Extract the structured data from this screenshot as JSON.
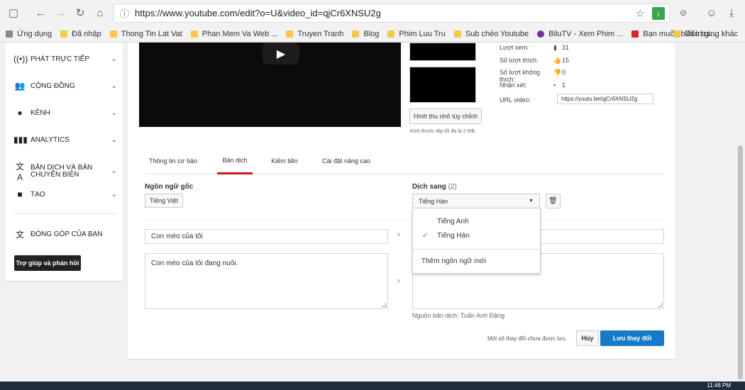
{
  "browser": {
    "url": "https://www.youtube.com/edit?o=U&video_id=qjCr6XNSU2g",
    "bookmarks": [
      "Ứng dụng",
      "Đã nhập",
      "Thong Tin Lat Vat",
      "Phan Mem Va Web ...",
      "Truyen Tranh",
      "Blog",
      "Phim Luu Tru",
      "Sub chéo Youtube",
      "BiluTV - Xem Phim ...",
      "Bạn muốn biết trị gi...",
      "Dấu trang khác"
    ],
    "icons": [
      "back-icon",
      "forward-icon",
      "reload-icon",
      "home-icon",
      "info-icon",
      "star-icon",
      "extension-icon",
      "menu-icon"
    ]
  },
  "sidebar": {
    "items": [
      {
        "label": "PHÁT TRỰC TIẾP",
        "icon": "live-icon"
      },
      {
        "label": "CỘNG ĐỒNG",
        "icon": "community-icon"
      },
      {
        "label": "KÊNH",
        "icon": "channel-icon"
      },
      {
        "label": "ANALYTICS",
        "icon": "analytics-icon"
      },
      {
        "label": "BẢN DỊCH VÀ BẢN CHUYỂN BIÊN",
        "icon": "translate-icon"
      },
      {
        "label": "TẠO",
        "icon": "create-icon"
      },
      {
        "label": "ĐÓNG GÓP CỦA BẠN",
        "icon": "contribute-icon"
      }
    ],
    "help_label": "Trợ giúp và phản hồi"
  },
  "video": {
    "custom_thumb_label": "Hình thu nhỏ tùy chỉnh",
    "thumb_note": "Kích thước tệp tối đa là 2 MB."
  },
  "stats": [
    {
      "label": "Lượt xem:",
      "value": "31",
      "icon": "bar-chart-icon"
    },
    {
      "label": "Số lượt thích:",
      "value": "15",
      "icon": "thumb-up-icon"
    },
    {
      "label": "Số lượt không thích:",
      "value": "0",
      "icon": "thumb-down-icon"
    },
    {
      "label": "Nhận xét:",
      "value": "1",
      "icon": "comment-icon"
    }
  ],
  "video_url": {
    "label": "URL video:",
    "value": "https://youtu.be/qjCr6XNSU2g"
  },
  "tabs": [
    {
      "label": "Thông tin cơ bản",
      "active": false
    },
    {
      "label": "Bản dịch",
      "active": true
    },
    {
      "label": "Kiếm tiền",
      "active": false
    },
    {
      "label": "Cài đặt nâng cao",
      "active": false
    }
  ],
  "source_lang": {
    "heading": "Ngôn ngữ gốc",
    "value": "Tiếng Việt"
  },
  "target_lang": {
    "heading": "Dịch sang",
    "count": "(2)",
    "selected": "Tiếng Hàn"
  },
  "dropdown": {
    "options": [
      "Tiếng Anh",
      "Tiếng Hàn"
    ],
    "checked_index": 1,
    "add_label": "Thêm ngôn ngữ mới"
  },
  "fields": {
    "title_original": "Con mèo của tôi",
    "description_original": "Con mèo của tôi đang nuôi."
  },
  "footer": {
    "source_credit": "Nguồn bản dịch: Tuấn Anh Đặng",
    "unsaved_note": "Một số thay đổi chưa được lưu.",
    "cancel_label": "Hủy",
    "save_label": "Lưu thay đổi"
  },
  "taskbar": {
    "time": "11:46 PM"
  },
  "colors": {
    "accent_red": "#cc181e",
    "save_blue": "#167ac6"
  }
}
